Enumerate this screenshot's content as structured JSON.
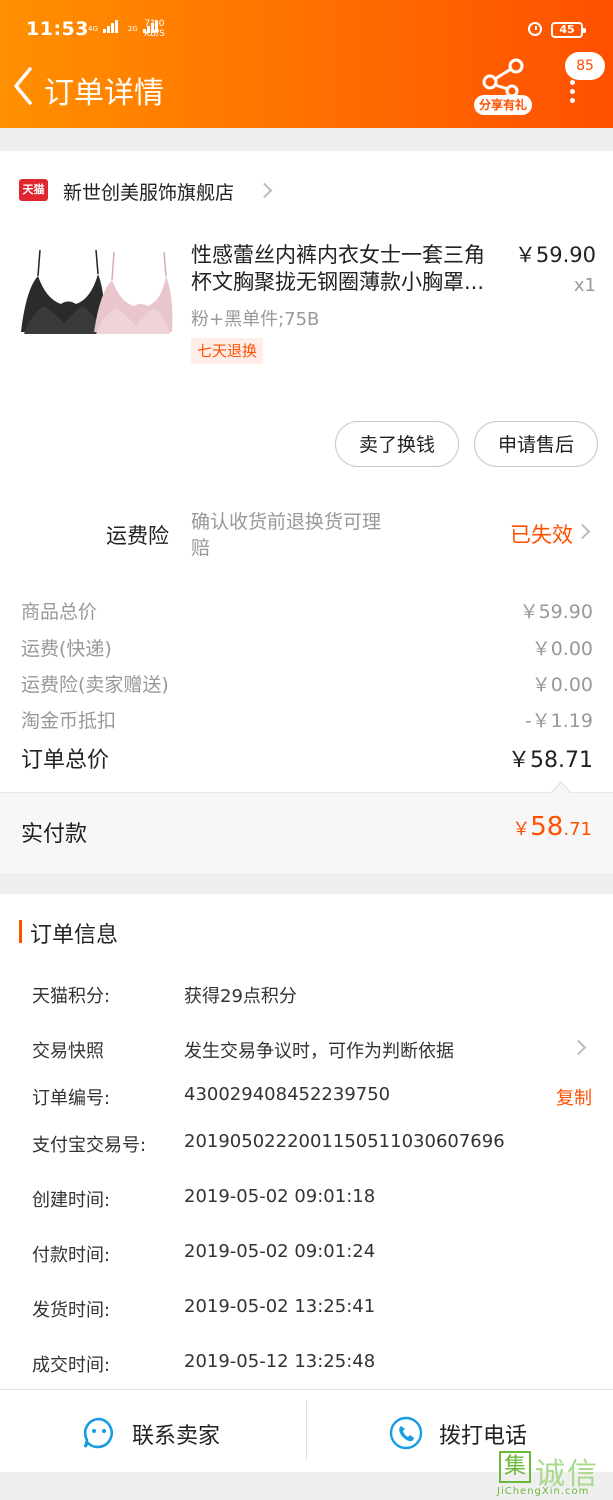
{
  "status_bar": {
    "time": "11:53",
    "net1": "4G",
    "net2": "2G",
    "speed_value": "71.0",
    "speed_unit": "KB/S",
    "battery": "45"
  },
  "header": {
    "title": "订单详情",
    "share_label": "分享有礼",
    "badge_count": "85"
  },
  "shop": {
    "logo_text": "天猫",
    "name": "新世创美服饰旗舰店"
  },
  "product": {
    "title_line1": "性感蕾丝内裤内衣女士一套三角",
    "title_line2": "杯文胸聚拢无钢圈薄款小胸罩...",
    "price": "￥59.90",
    "quantity": "x1",
    "sku": "粉+黑单件;75B",
    "return_tag": "七天退换"
  },
  "actions": {
    "resell_label": "卖了换钱",
    "aftersale_label": "申请售后"
  },
  "freight_insurance": {
    "label": "运费险",
    "desc_line1": "确认收货前退换货可理",
    "desc_line2": "赔",
    "status": "已失效"
  },
  "price_summary": {
    "rows": [
      {
        "label": "商品总价",
        "value": "￥59.90"
      },
      {
        "label": "运费(快递)",
        "value": "￥0.00"
      },
      {
        "label": "运费险(卖家赠送)",
        "value": "￥0.00"
      },
      {
        "label": "淘金币抵扣",
        "value": "-￥1.19"
      }
    ],
    "total_label": "订单总价",
    "total_value": "￥58.71",
    "paid_label": "实付款",
    "paid_currency": "￥",
    "paid_int": "58",
    "paid_dec": ".71"
  },
  "order_info": {
    "section_title": "订单信息",
    "points_label": "天猫积分:",
    "points_value": "获得29点积分",
    "snapshot_label": "交易快照",
    "snapshot_value": "发生交易争议时，可作为判断依据",
    "order_no_label": "订单编号:",
    "order_no_value": "430029408452239750",
    "copy_label": "复制",
    "alipay_label": "支付宝交易号:",
    "alipay_value": "2019050222001150511030607696",
    "created_label": "创建时间:",
    "created_value": "2019-05-02 09:01:18",
    "paid_time_label": "付款时间:",
    "paid_time_value": "2019-05-02 09:01:24",
    "shipped_label": "发货时间:",
    "shipped_value": "2019-05-02 13:25:41",
    "completed_label": "成交时间:",
    "completed_value": "2019-05-12 13:25:48"
  },
  "bottom_bar": {
    "contact_label": "联系卖家",
    "call_label": "拨打电话"
  },
  "watermark": {
    "char1": "集",
    "chars": "诚信",
    "url": "JiChengXin.com"
  },
  "colors": {
    "brand_orange": "#ff5000",
    "header_start": "#ff9000",
    "accent_blue": "#1a9ce0"
  }
}
